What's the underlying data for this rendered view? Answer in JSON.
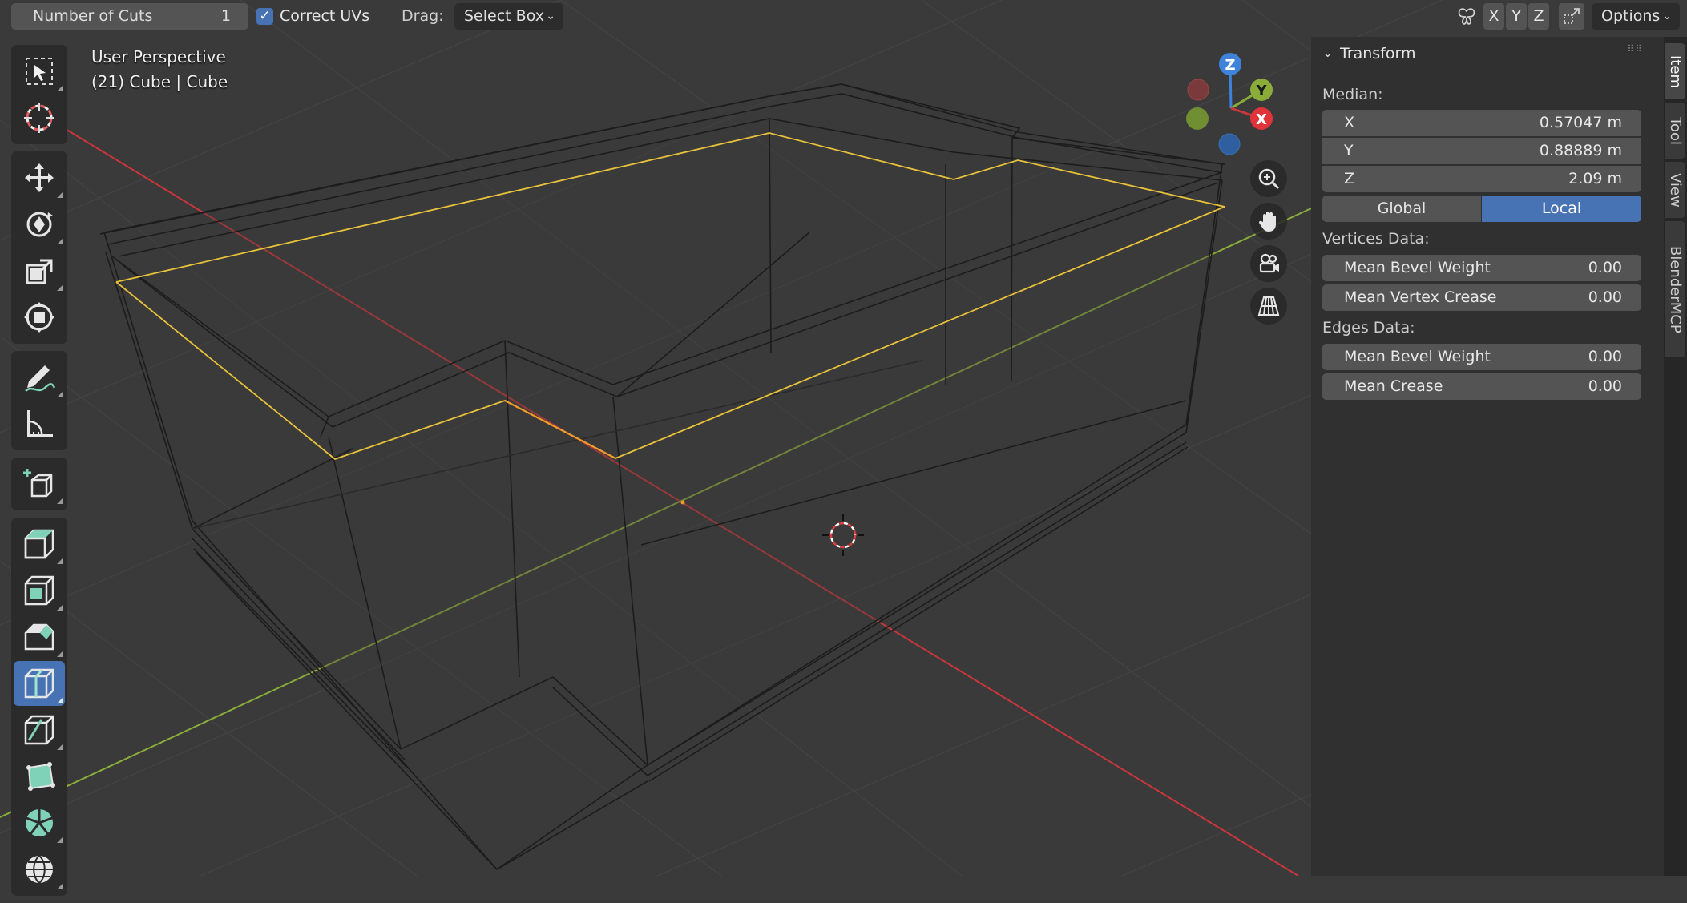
{
  "header": {
    "cuts_label": "Number of Cuts",
    "cuts_value": "1",
    "correct_uvs": "Correct UVs",
    "drag_label": "Drag:",
    "drag_value": "Select Box",
    "axis_x": "X",
    "axis_y": "Y",
    "axis_z": "Z",
    "options": "Options"
  },
  "viewport": {
    "view_name": "User Perspective",
    "object_info": "(21) Cube | Cube"
  },
  "gizmo": {
    "z": "Z",
    "y": "Y",
    "x": "X"
  },
  "toolbar": {
    "tools": [
      {
        "name": "select-box",
        "icon": "select-box-icon",
        "active": false
      },
      {
        "name": "cursor",
        "icon": "cursor-icon",
        "active": false
      },
      {
        "name": "move",
        "icon": "move-icon",
        "active": false
      },
      {
        "name": "rotate",
        "icon": "rotate-icon",
        "active": false
      },
      {
        "name": "scale",
        "icon": "scale-icon",
        "active": false
      },
      {
        "name": "transform",
        "icon": "transform-icon",
        "active": false
      },
      {
        "name": "annotate",
        "icon": "annotate-icon",
        "active": false
      },
      {
        "name": "measure",
        "icon": "measure-icon",
        "active": false
      },
      {
        "name": "add-cube",
        "icon": "add-cube-icon",
        "active": false
      },
      {
        "name": "extrude",
        "icon": "extrude-icon",
        "active": false
      },
      {
        "name": "inset",
        "icon": "inset-icon",
        "active": false
      },
      {
        "name": "bevel",
        "icon": "bevel-icon",
        "active": false
      },
      {
        "name": "loop-cut",
        "icon": "loop-cut-icon",
        "active": true
      },
      {
        "name": "knife",
        "icon": "knife-icon",
        "active": false
      },
      {
        "name": "poly-build",
        "icon": "poly-build-icon",
        "active": false
      },
      {
        "name": "spin",
        "icon": "spin-icon",
        "active": false
      },
      {
        "name": "smooth",
        "icon": "smooth-icon",
        "active": false
      }
    ]
  },
  "panel": {
    "title": "Transform",
    "median": "Median:",
    "x_label": "X",
    "x_value": "0.57047 m",
    "y_label": "Y",
    "y_value": "0.88889 m",
    "z_label": "Z",
    "z_value": "2.09 m",
    "global": "Global",
    "local": "Local",
    "vertices_data": "Vertices Data:",
    "v_bevel_label": "Mean Bevel Weight",
    "v_bevel_value": "0.00",
    "v_crease_label": "Mean Vertex Crease",
    "v_crease_value": "0.00",
    "edges_data": "Edges Data:",
    "e_bevel_label": "Mean Bevel Weight",
    "e_bevel_value": "0.00",
    "e_crease_label": "Mean Crease",
    "e_crease_value": "0.00"
  },
  "tabs": [
    "Item",
    "Tool",
    "View",
    "BlenderMCP"
  ],
  "colors": {
    "accent": "#4772b3",
    "selection": "#e8c23a",
    "x_axis": "#c9363b",
    "y_axis": "#8aad3a",
    "z_axis": "#3f82d9"
  }
}
